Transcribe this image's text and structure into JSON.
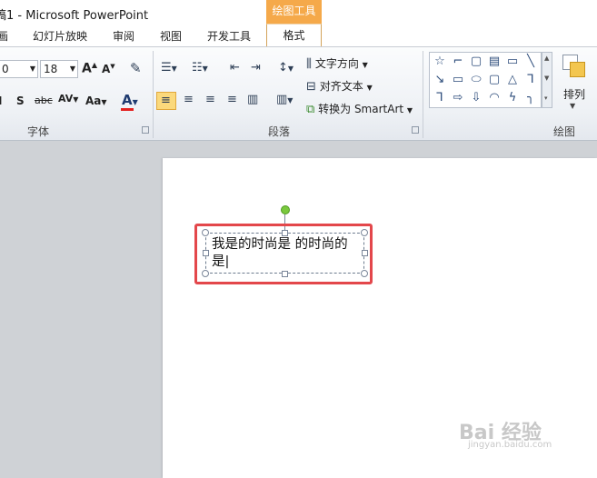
{
  "app": {
    "title": "稿1 - Microsoft PowerPoint",
    "context_tab": "绘图工具"
  },
  "tabs": [
    "画",
    "幻灯片放映",
    "审阅",
    "视图",
    "开发工具",
    "格式"
  ],
  "font_group": {
    "font_name": "0",
    "font_size": "18",
    "grow_icon": "A",
    "shrink_icon": "A",
    "shadow_label": "S",
    "strike_label": "abc",
    "spacing_label": "AV",
    "case_label": "Aa",
    "color_label": "A",
    "group_label": "字体"
  },
  "paragraph_group": {
    "text_direction": "文字方向",
    "align_text": "对齐文本",
    "convert_smartart": "转换为 SmartArt",
    "group_label": "段落"
  },
  "drawing_group": {
    "arrange_label": "排列",
    "group_label": "绘图",
    "shapes": [
      "☆",
      "⌐",
      "▢",
      "▤",
      "▭",
      "╲",
      "↘",
      "▭",
      "⬭",
      "▢",
      "△",
      "⅂",
      "⅂",
      "⇨",
      "⇩",
      "◠",
      "ϟ",
      "╮"
    ]
  },
  "slide": {
    "textbox_text": "我是的时尚是 的时尚的是|"
  },
  "watermark": {
    "main": "Bai 经验",
    "sub": "jingyan.baidu.com"
  },
  "colors": {
    "accent": "#f5a94a",
    "highlight": "#e3474b",
    "font_color": "#e3211f"
  }
}
